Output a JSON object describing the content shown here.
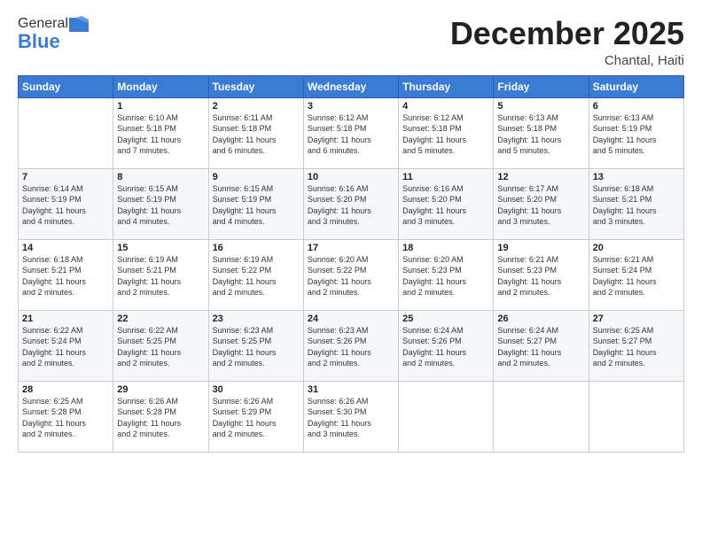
{
  "logo": {
    "general": "General",
    "blue": "Blue"
  },
  "title": "December 2025",
  "location": "Chantal, Haiti",
  "days_of_week": [
    "Sunday",
    "Monday",
    "Tuesday",
    "Wednesday",
    "Thursday",
    "Friday",
    "Saturday"
  ],
  "weeks": [
    [
      {
        "day": "",
        "info": ""
      },
      {
        "day": "1",
        "info": "Sunrise: 6:10 AM\nSunset: 5:18 PM\nDaylight: 11 hours\nand 7 minutes."
      },
      {
        "day": "2",
        "info": "Sunrise: 6:11 AM\nSunset: 5:18 PM\nDaylight: 11 hours\nand 6 minutes."
      },
      {
        "day": "3",
        "info": "Sunrise: 6:12 AM\nSunset: 5:18 PM\nDaylight: 11 hours\nand 6 minutes."
      },
      {
        "day": "4",
        "info": "Sunrise: 6:12 AM\nSunset: 5:18 PM\nDaylight: 11 hours\nand 5 minutes."
      },
      {
        "day": "5",
        "info": "Sunrise: 6:13 AM\nSunset: 5:18 PM\nDaylight: 11 hours\nand 5 minutes."
      },
      {
        "day": "6",
        "info": "Sunrise: 6:13 AM\nSunset: 5:19 PM\nDaylight: 11 hours\nand 5 minutes."
      }
    ],
    [
      {
        "day": "7",
        "info": "Sunrise: 6:14 AM\nSunset: 5:19 PM\nDaylight: 11 hours\nand 4 minutes."
      },
      {
        "day": "8",
        "info": "Sunrise: 6:15 AM\nSunset: 5:19 PM\nDaylight: 11 hours\nand 4 minutes."
      },
      {
        "day": "9",
        "info": "Sunrise: 6:15 AM\nSunset: 5:19 PM\nDaylight: 11 hours\nand 4 minutes."
      },
      {
        "day": "10",
        "info": "Sunrise: 6:16 AM\nSunset: 5:20 PM\nDaylight: 11 hours\nand 3 minutes."
      },
      {
        "day": "11",
        "info": "Sunrise: 6:16 AM\nSunset: 5:20 PM\nDaylight: 11 hours\nand 3 minutes."
      },
      {
        "day": "12",
        "info": "Sunrise: 6:17 AM\nSunset: 5:20 PM\nDaylight: 11 hours\nand 3 minutes."
      },
      {
        "day": "13",
        "info": "Sunrise: 6:18 AM\nSunset: 5:21 PM\nDaylight: 11 hours\nand 3 minutes."
      }
    ],
    [
      {
        "day": "14",
        "info": "Sunrise: 6:18 AM\nSunset: 5:21 PM\nDaylight: 11 hours\nand 2 minutes."
      },
      {
        "day": "15",
        "info": "Sunrise: 6:19 AM\nSunset: 5:21 PM\nDaylight: 11 hours\nand 2 minutes."
      },
      {
        "day": "16",
        "info": "Sunrise: 6:19 AM\nSunset: 5:22 PM\nDaylight: 11 hours\nand 2 minutes."
      },
      {
        "day": "17",
        "info": "Sunrise: 6:20 AM\nSunset: 5:22 PM\nDaylight: 11 hours\nand 2 minutes."
      },
      {
        "day": "18",
        "info": "Sunrise: 6:20 AM\nSunset: 5:23 PM\nDaylight: 11 hours\nand 2 minutes."
      },
      {
        "day": "19",
        "info": "Sunrise: 6:21 AM\nSunset: 5:23 PM\nDaylight: 11 hours\nand 2 minutes."
      },
      {
        "day": "20",
        "info": "Sunrise: 6:21 AM\nSunset: 5:24 PM\nDaylight: 11 hours\nand 2 minutes."
      }
    ],
    [
      {
        "day": "21",
        "info": "Sunrise: 6:22 AM\nSunset: 5:24 PM\nDaylight: 11 hours\nand 2 minutes."
      },
      {
        "day": "22",
        "info": "Sunrise: 6:22 AM\nSunset: 5:25 PM\nDaylight: 11 hours\nand 2 minutes."
      },
      {
        "day": "23",
        "info": "Sunrise: 6:23 AM\nSunset: 5:25 PM\nDaylight: 11 hours\nand 2 minutes."
      },
      {
        "day": "24",
        "info": "Sunrise: 6:23 AM\nSunset: 5:26 PM\nDaylight: 11 hours\nand 2 minutes."
      },
      {
        "day": "25",
        "info": "Sunrise: 6:24 AM\nSunset: 5:26 PM\nDaylight: 11 hours\nand 2 minutes."
      },
      {
        "day": "26",
        "info": "Sunrise: 6:24 AM\nSunset: 5:27 PM\nDaylight: 11 hours\nand 2 minutes."
      },
      {
        "day": "27",
        "info": "Sunrise: 6:25 AM\nSunset: 5:27 PM\nDaylight: 11 hours\nand 2 minutes."
      }
    ],
    [
      {
        "day": "28",
        "info": "Sunrise: 6:25 AM\nSunset: 5:28 PM\nDaylight: 11 hours\nand 2 minutes."
      },
      {
        "day": "29",
        "info": "Sunrise: 6:26 AM\nSunset: 5:28 PM\nDaylight: 11 hours\nand 2 minutes."
      },
      {
        "day": "30",
        "info": "Sunrise: 6:26 AM\nSunset: 5:29 PM\nDaylight: 11 hours\nand 2 minutes."
      },
      {
        "day": "31",
        "info": "Sunrise: 6:26 AM\nSunset: 5:30 PM\nDaylight: 11 hours\nand 3 minutes."
      },
      {
        "day": "",
        "info": ""
      },
      {
        "day": "",
        "info": ""
      },
      {
        "day": "",
        "info": ""
      }
    ]
  ]
}
